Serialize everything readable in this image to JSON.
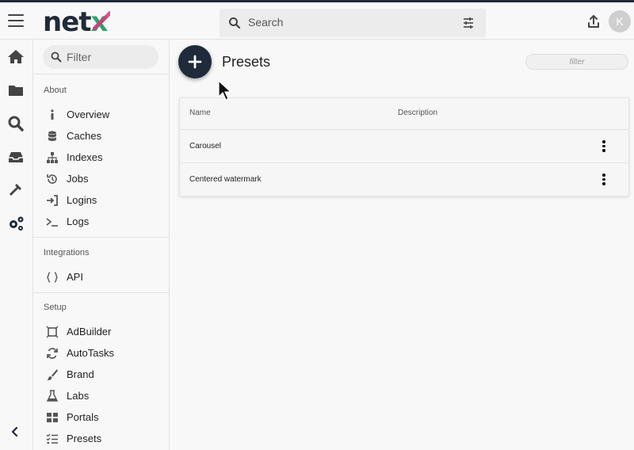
{
  "header": {
    "logo_prefix": "net",
    "logo_suffix": "x",
    "search_placeholder": "Search",
    "avatar_initial": "K"
  },
  "rail": {
    "icons": [
      "home-icon",
      "folder-icon",
      "search-icon",
      "inbox-icon",
      "hammer-icon",
      "gears-icon"
    ],
    "collapse_icon": "chevron-left-icon"
  },
  "sidebar": {
    "filter_placeholder": "Filter",
    "sections": [
      {
        "title": "About",
        "items": [
          {
            "label": "Overview",
            "icon": "info-icon"
          },
          {
            "label": "Caches",
            "icon": "database-icon"
          },
          {
            "label": "Indexes",
            "icon": "sitemap-icon"
          },
          {
            "label": "Jobs",
            "icon": "history-icon"
          },
          {
            "label": "Logins",
            "icon": "login-icon"
          },
          {
            "label": "Logs",
            "icon": "terminal-icon"
          }
        ]
      },
      {
        "title": "Integrations",
        "items": [
          {
            "label": "API",
            "icon": "code-braces-icon"
          }
        ]
      },
      {
        "title": "Setup",
        "items": [
          {
            "label": "AdBuilder",
            "icon": "adbuilder-icon"
          },
          {
            "label": "AutoTasks",
            "icon": "sync-icon"
          },
          {
            "label": "Brand",
            "icon": "brush-icon"
          },
          {
            "label": "Labs",
            "icon": "flask-icon"
          },
          {
            "label": "Portals",
            "icon": "grid-icon"
          },
          {
            "label": "Presets",
            "icon": "list-check-icon"
          }
        ]
      }
    ]
  },
  "main": {
    "title": "Presets",
    "filter_placeholder": "filter",
    "table": {
      "columns": [
        "Name",
        "Description"
      ],
      "rows": [
        {
          "name": "Carousel",
          "description": ""
        },
        {
          "name": "Centered watermark",
          "description": ""
        }
      ]
    }
  },
  "colors": {
    "brand_navy": "#1f2a3a",
    "logo_green": "#2ea36a",
    "logo_pink": "#d6397a"
  }
}
